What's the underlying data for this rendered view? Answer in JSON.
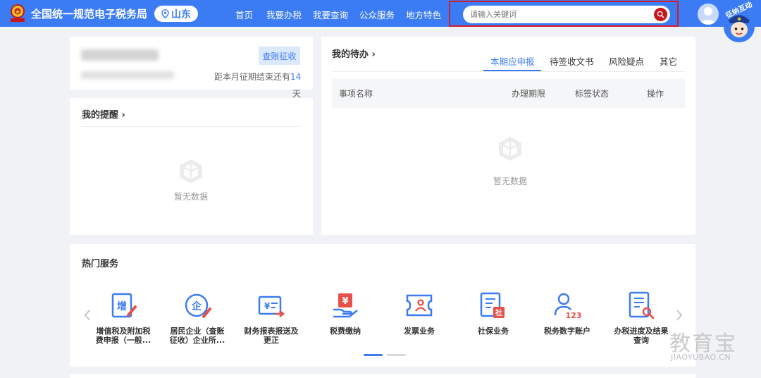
{
  "header": {
    "site_title": "全国统一规范电子税务局",
    "region": "山东",
    "nav": [
      "首页",
      "我要办税",
      "我要查询",
      "公众服务",
      "地方特色"
    ],
    "search_placeholder": "请输入关键词",
    "mascot_text": "征纳互动"
  },
  "account": {
    "tag_label": "查账征收",
    "deadline_prefix": "距本月征期结束还有",
    "deadline_days": "14",
    "deadline_unit": "天"
  },
  "reminders": {
    "title": "我的提醒",
    "empty_text": "暂无数据"
  },
  "todo": {
    "title": "我的待办",
    "tabs": [
      "本期应申报",
      "待签收文书",
      "风险疑点",
      "其它"
    ],
    "active_tab": 0,
    "columns": [
      "事项名称",
      "办理期限",
      "标签状态",
      "操作"
    ],
    "empty_text": "暂无数据"
  },
  "hot_services": {
    "title": "热门服务",
    "items": [
      {
        "line1": "增值税及附加税",
        "line2": "费申报（一般...",
        "icon": "vat-icon"
      },
      {
        "line1": "居民企业（查账",
        "line2": "征收）企业所...",
        "icon": "enterprise-tax-icon"
      },
      {
        "line1": "财务报表报送及",
        "line2": "更正",
        "icon": "financial-report-icon"
      },
      {
        "line1": "税费缴纳",
        "line2": "",
        "icon": "tax-payment-icon"
      },
      {
        "line1": "发票业务",
        "line2": "",
        "icon": "invoice-icon"
      },
      {
        "line1": "社保业务",
        "line2": "",
        "icon": "social-insurance-icon"
      },
      {
        "line1": "税务数字账户",
        "line2": "",
        "icon": "digital-account-icon"
      },
      {
        "line1": "办税进度及结果",
        "line2": "查询",
        "icon": "progress-query-icon"
      }
    ],
    "pages": 2,
    "active_page": 0
  },
  "watermark": {
    "cn": "教育宝",
    "en": "JIAOYUBAO.CN"
  },
  "colors": {
    "primary": "#3b7cf4",
    "search_border": "#d41e2a",
    "page_bg": "#f0f2f5"
  }
}
